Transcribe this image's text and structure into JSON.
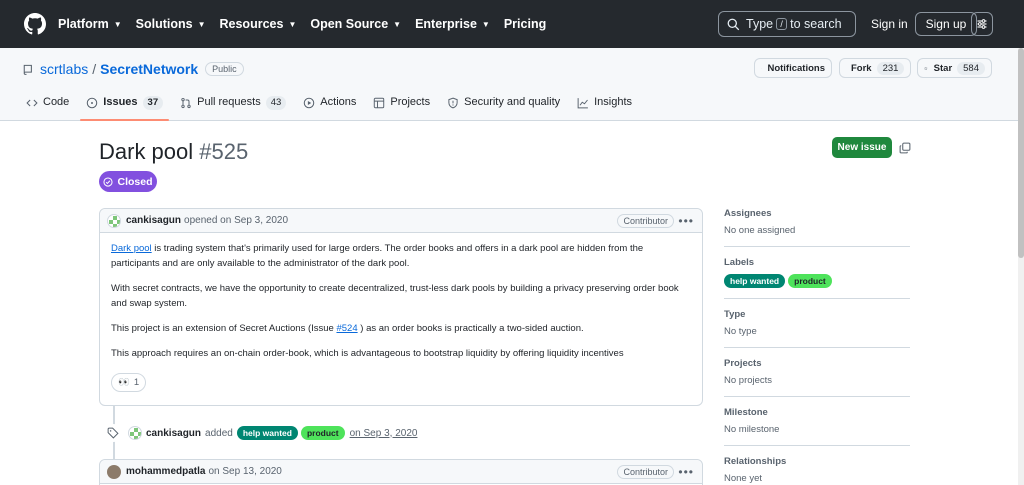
{
  "header": {
    "nav": [
      {
        "label": "Platform"
      },
      {
        "label": "Solutions"
      },
      {
        "label": "Resources"
      },
      {
        "label": "Open Source"
      },
      {
        "label": "Enterprise"
      },
      {
        "label": "Pricing"
      }
    ],
    "search_prefix": "Type",
    "search_key": "/",
    "search_suffix": "to search",
    "signin": "Sign in",
    "signup": "Sign up"
  },
  "repo": {
    "owner": "scrtlabs",
    "separator": "/",
    "name": "SecretNetwork",
    "visibility": "Public",
    "notifications_label": "Notifications",
    "fork_label": "Fork",
    "fork_count": "231",
    "star_label": "Star",
    "star_count": "584",
    "tabs": [
      {
        "label": "Code"
      },
      {
        "label": "Issues",
        "count": "37"
      },
      {
        "label": "Pull requests",
        "count": "43"
      },
      {
        "label": "Actions"
      },
      {
        "label": "Projects"
      },
      {
        "label": "Security and quality"
      },
      {
        "label": "Insights"
      }
    ]
  },
  "issue": {
    "title": "Dark pool",
    "number": "#525",
    "state": "Closed",
    "new_issue": "New issue"
  },
  "comment1": {
    "author": "cankisagun",
    "action": "opened on",
    "date": "Sep 3, 2020",
    "role": "Contributor",
    "p1_link": "Dark pool",
    "p1_rest": " is trading system that's primarily used for large orders. The order books and offers in a dark pool are hidden from the participants and are only available to the administrator of the dark pool.",
    "p2": "With secret contracts, we have the opportunity to create decentralized, trust-less dark pools by building a privacy preserving order book and swap system.",
    "p3_before": "This project is an extension of Secret Auctions (Issue ",
    "p3_link": "#524",
    "p3_after": " ) as an order books is practically a two-sided auction.",
    "p4": "This approach requires an on-chain order-book, which is advantageous to bootstrap liquidity by offering liquidity incentives",
    "reaction_emoji": "👀",
    "reaction_count": "1"
  },
  "event": {
    "author": "cankisagun",
    "action": "added",
    "label1": "help wanted",
    "label2": "product",
    "date_text": "on Sep 3, 2020"
  },
  "comment2": {
    "author": "mohammedpatla",
    "action": "on",
    "date": "Sep 13, 2020",
    "role": "Contributor"
  },
  "sidebar": {
    "assignees_title": "Assignees",
    "assignees_value": "No one assigned",
    "labels_title": "Labels",
    "label1": "help wanted",
    "label2": "product",
    "type_title": "Type",
    "type_value": "No type",
    "projects_title": "Projects",
    "projects_value": "No projects",
    "milestone_title": "Milestone",
    "milestone_value": "No milestone",
    "relationships_title": "Relationships",
    "relationships_value": "None yet"
  },
  "colors": {
    "header_bg": "#25292e",
    "closed_purple": "#8250df",
    "green_button": "#1f883d",
    "link_blue": "#0969da",
    "label_help": "#008672",
    "label_product": "#4ee35b"
  }
}
